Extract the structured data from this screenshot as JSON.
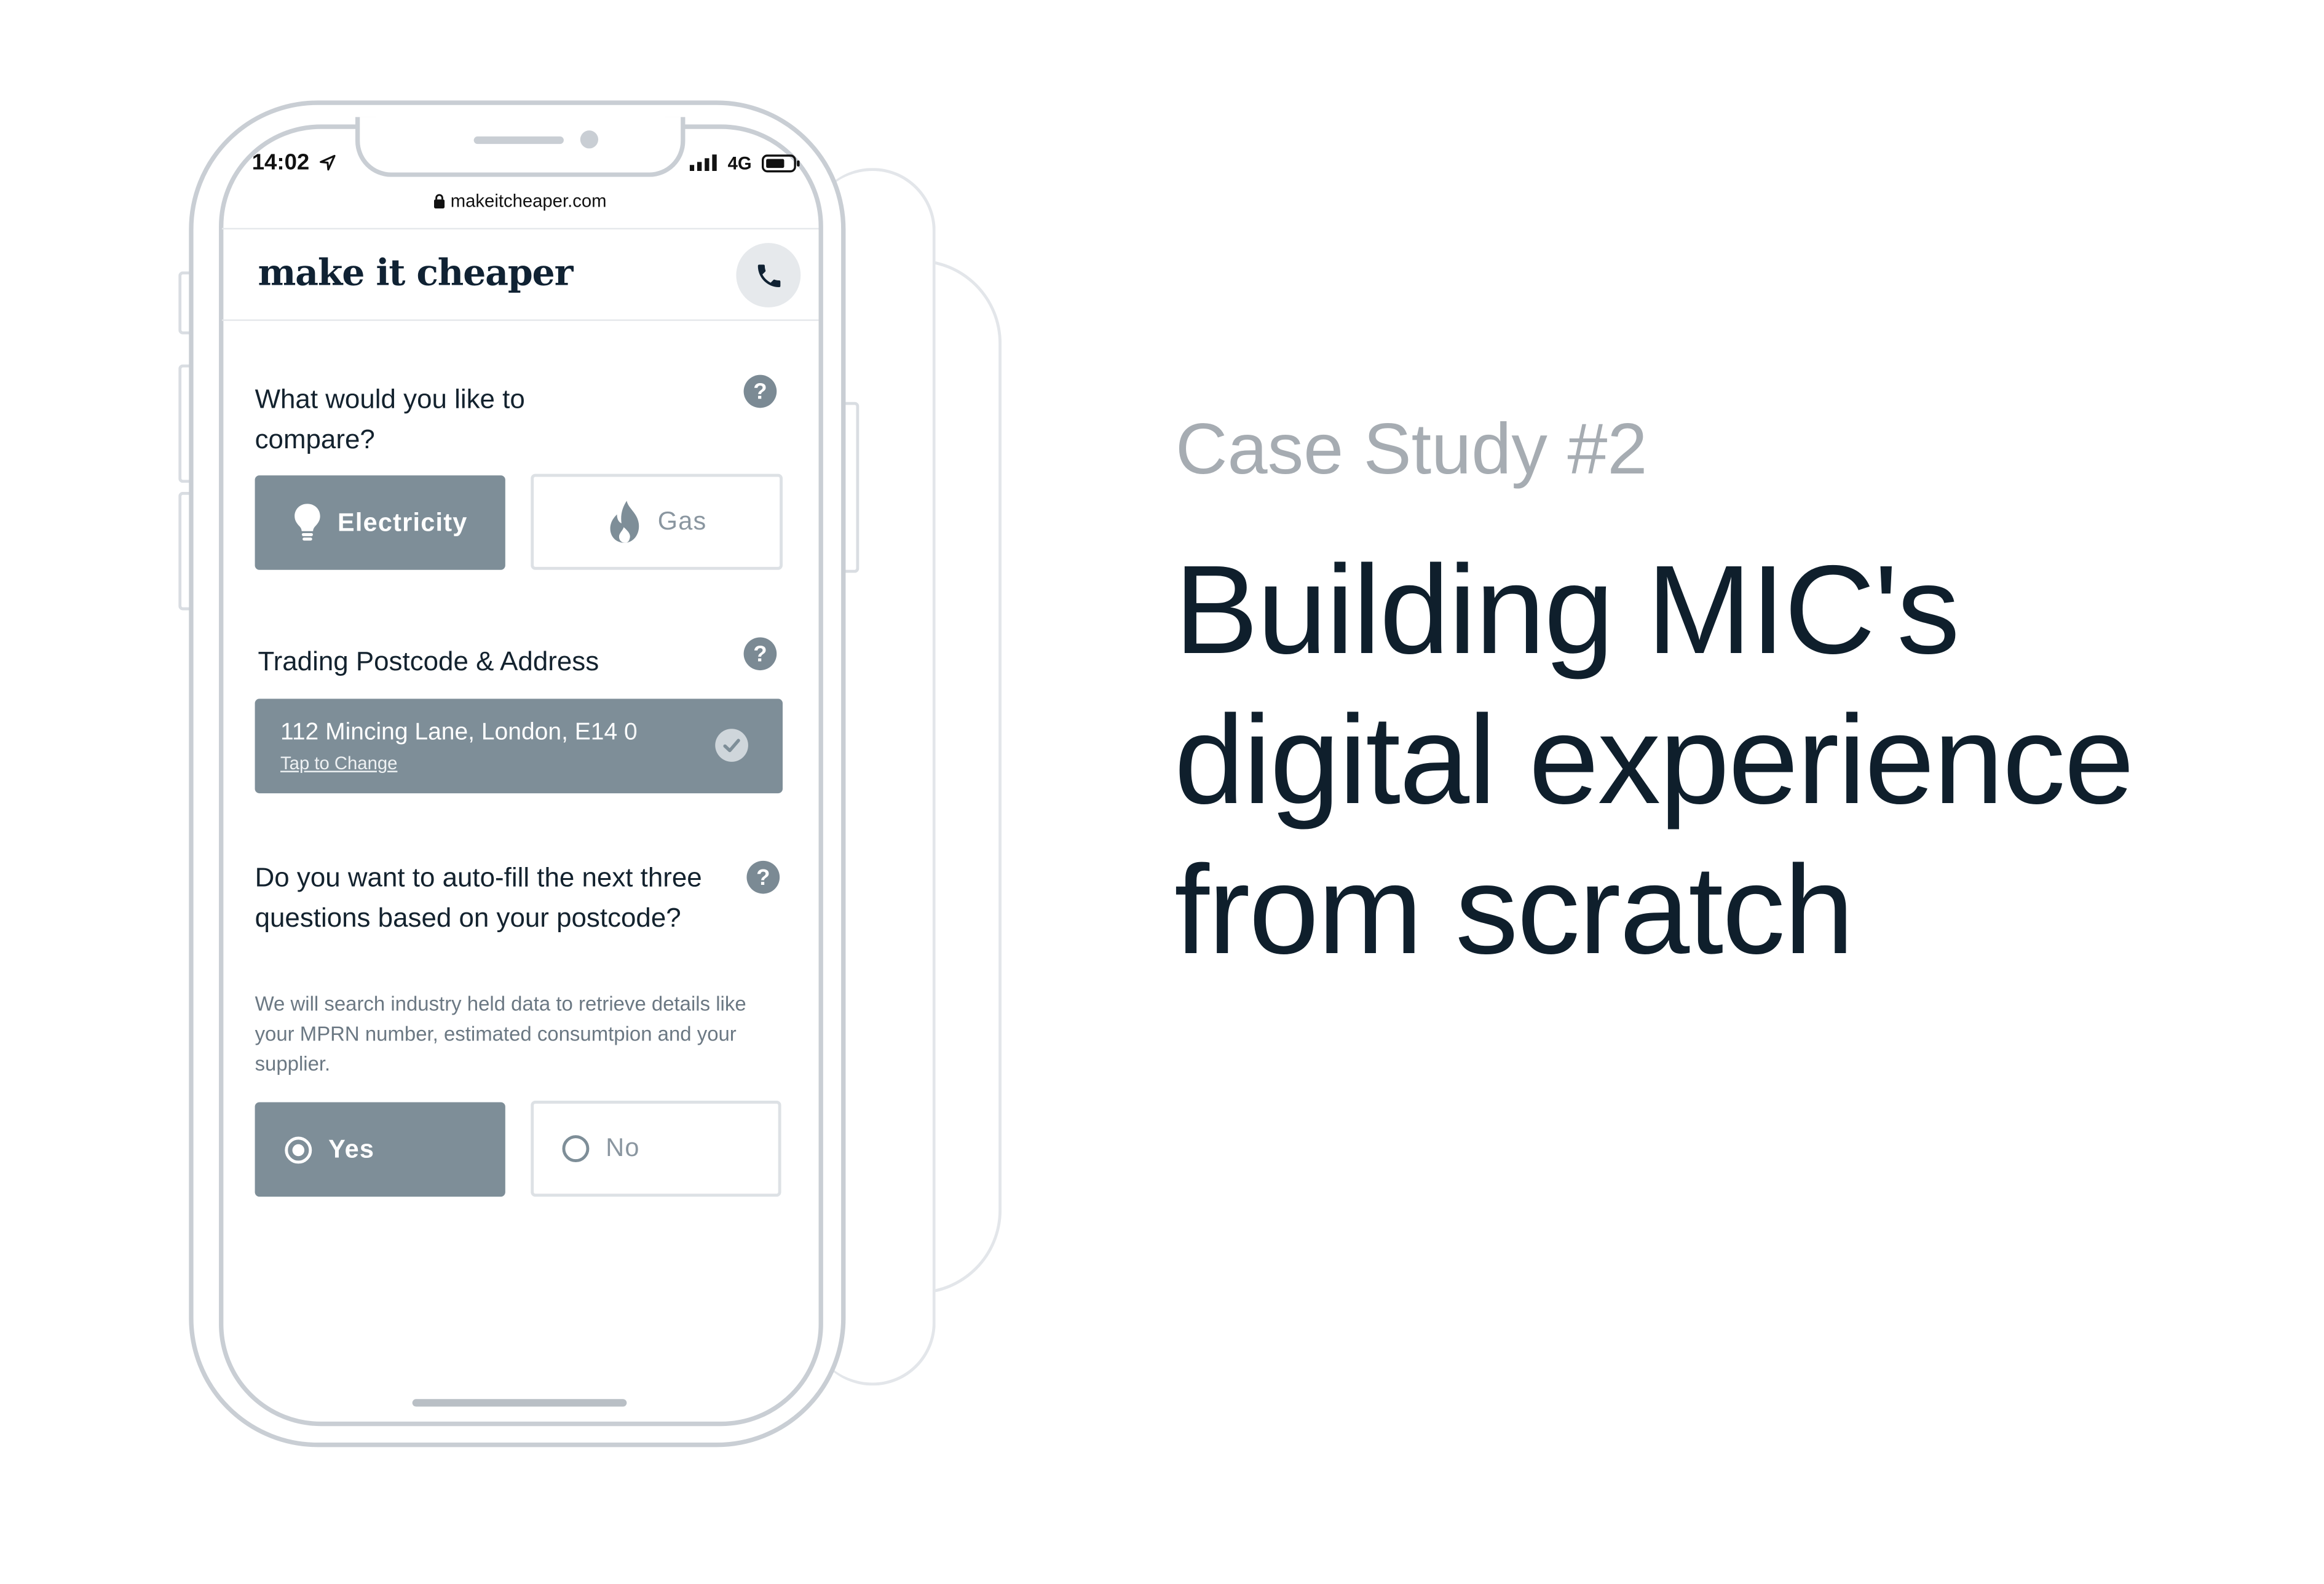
{
  "browser": {
    "time": "14:02",
    "network": "4G",
    "url": "makeitcheaper.com"
  },
  "app": {
    "logo_text": "make it cheaper",
    "call_icon": "phone-icon"
  },
  "form": {
    "compare_question": "What would you like to compare?",
    "options": {
      "electricity": "Electricity",
      "gas": "Gas",
      "selected": "Electricity"
    },
    "postcode_label": "Trading Postcode & Address",
    "address_value": "112 Mincing Lane, London, E14 0",
    "address_change": "Tap to Change",
    "autofill_question": "Do you want to auto-fill the next three questions based on your postcode?",
    "autofill_helper": "We will search industry held data to retrieve details like your MPRN number, estimated consumtpion and your supplier.",
    "yes_label": "Yes",
    "no_label": "No",
    "autofill_selected": "Yes"
  },
  "hero": {
    "eyebrow": "Case Study #2",
    "headline": "Building MIC's digital experience from scratch"
  },
  "colors": {
    "accent": "#7e8e98",
    "headline": "#0f1f2c",
    "eyebrow": "#a6acb2"
  }
}
